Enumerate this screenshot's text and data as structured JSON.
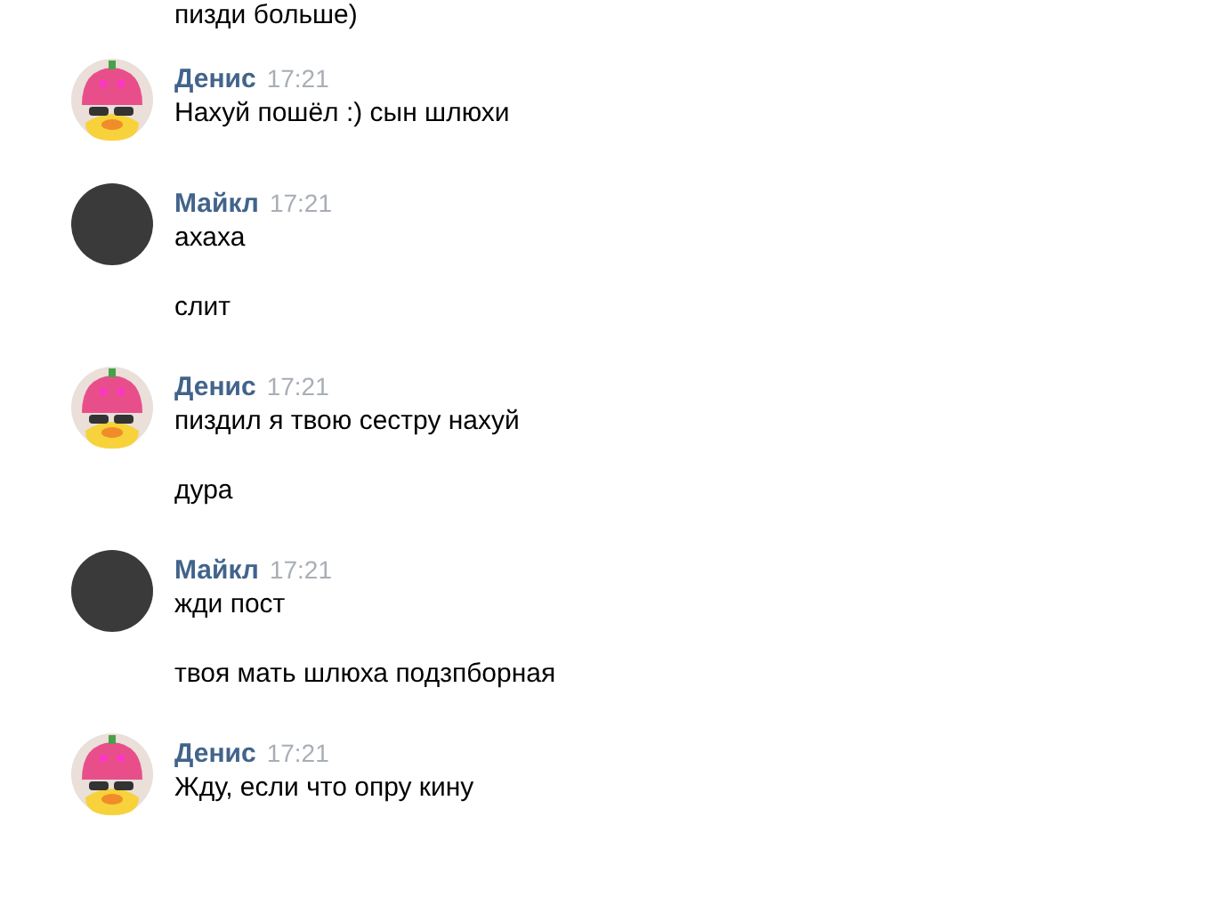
{
  "previous_message": "пизди больше)",
  "groups": [
    {
      "kind": "duck",
      "author": "Денис",
      "time": "17:21",
      "messages": [
        "Нахуй пошёл :) сын шлюхи"
      ]
    },
    {
      "kind": "photo",
      "author": "Майкл",
      "time": "17:21",
      "messages": [
        "ахаха",
        "слит"
      ]
    },
    {
      "kind": "duck",
      "author": "Денис",
      "time": "17:21",
      "messages": [
        "пиздил я твою сестру нахуй",
        "дура"
      ]
    },
    {
      "kind": "photo",
      "author": "Майкл",
      "time": "17:21",
      "messages": [
        "жди пост",
        "твоя мать шлюха подзпборная"
      ]
    },
    {
      "kind": "duck",
      "author": "Денис",
      "time": "17:21",
      "messages": [
        "Жду, если что опру кину"
      ]
    }
  ]
}
